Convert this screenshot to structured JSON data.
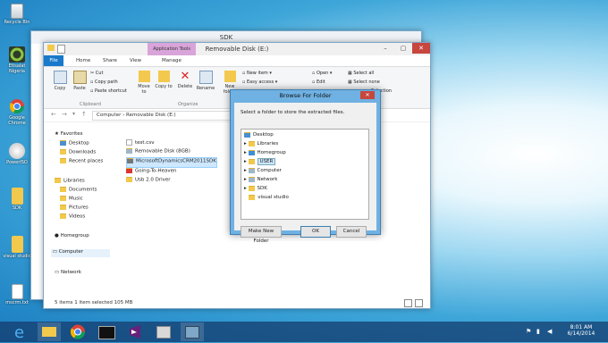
{
  "desktop_icons": [
    {
      "label": "Recycle Bin"
    },
    {
      "label": "Etisalat Nigeria"
    },
    {
      "label": "Google Chrome"
    },
    {
      "label": "PowerISO"
    },
    {
      "label": "SDK"
    },
    {
      "label": "visual studio"
    },
    {
      "label": "mscrm.txt"
    }
  ],
  "back_window": {
    "title": "SDK"
  },
  "explorer": {
    "title": "Removable Disk (E:)",
    "context_tab": "Application Tools",
    "tabs": [
      "File",
      "Home",
      "Share",
      "View",
      "Manage"
    ],
    "ribbon": {
      "copy": "Copy",
      "paste": "Paste",
      "cut": "Cut",
      "copy_path": "Copy path",
      "paste_shortcut": "Paste shortcut",
      "move_to": "Move to",
      "copy_to": "Copy to",
      "delete": "Delete",
      "rename": "Rename",
      "new_folder": "New folder",
      "new_item": "New item",
      "easy_access": "Easy access",
      "open": "Open",
      "edit": "Edit",
      "select_all": "Select all",
      "select_none": "Select none",
      "selection": "Selection",
      "group_clipboard": "Clipboard",
      "group_organize": "Organize"
    },
    "address": "Computer  ›  Removable Disk (E:)",
    "nav": {
      "favorites": "Favorites",
      "desktop": "Desktop",
      "downloads": "Downloads",
      "recent": "Recent places",
      "libraries": "Libraries",
      "documents": "Documents",
      "music": "Music",
      "pictures": "Pictures",
      "videos": "Videos",
      "homegroup": "Homegroup",
      "computer": "Computer",
      "network": "Network"
    },
    "files": [
      "test.csv",
      "Removable Disk (8GB)",
      "MicrosoftDynamicsCRM2011SDK",
      "Going-To-Heaven",
      "Usb 2.0 Driver"
    ],
    "status": "5 items    1 item selected  105 MB"
  },
  "dialog": {
    "title": "Browse For Folder",
    "prompt": "Select a folder to store the extracted files.",
    "tree": [
      "Desktop",
      "Libraries",
      "Homegroup",
      "USER",
      "Computer",
      "Network",
      "SDK",
      "visual studio"
    ],
    "make_new_folder": "Make New Folder",
    "ok": "OK",
    "cancel": "Cancel"
  },
  "taskbar": {
    "time": "8:01 AM",
    "date": "6/14/2014"
  }
}
